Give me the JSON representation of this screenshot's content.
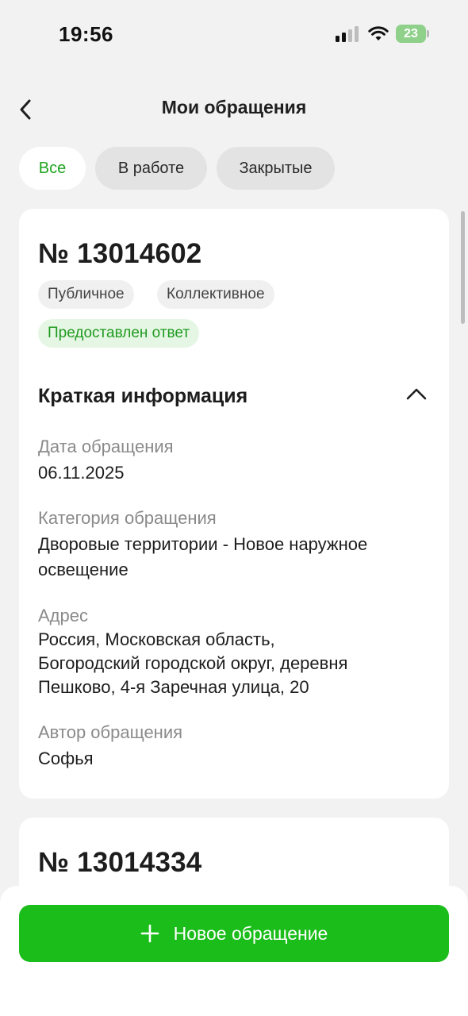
{
  "status_bar": {
    "time": "19:56",
    "battery": "23"
  },
  "header": {
    "title": "Мои обращения",
    "back_icon": "chevron-left-icon"
  },
  "filters": {
    "items": [
      {
        "label": "Все",
        "selected": true
      },
      {
        "label": "В работе",
        "selected": false
      },
      {
        "label": "Закрытые",
        "selected": false
      }
    ]
  },
  "requests": [
    {
      "number": "№ 13014602",
      "tags": [
        "Публичное",
        "Коллективное"
      ],
      "status": "Предоставлен ответ",
      "section_title": "Краткая информация",
      "section_icon": "chevron-up-icon",
      "fields": [
        {
          "label": "Дата обращения",
          "value": "06.11.2025"
        },
        {
          "label": "Категория обращения",
          "value_lines": [
            "Дворовые территории - Новое наружное",
            "освещение"
          ]
        },
        {
          "label": "Адрес",
          "value_lines": [
            "Россия, Московская область,",
            "Богородский городской округ, деревня",
            "Пешково, 4-я Заречная улица, 20"
          ]
        },
        {
          "label": "Автор обращения",
          "value": "Софья"
        }
      ]
    },
    {
      "number": "№ 13014334"
    }
  ],
  "actions": {
    "new_request_label": "Новое обращение",
    "new_request_icon": "plus-icon"
  },
  "colors": {
    "accent": "#1bbd1b",
    "status_text": "#1f9a1f",
    "status_bg": "#e6f6e4",
    "background": "#f2f2f2"
  }
}
